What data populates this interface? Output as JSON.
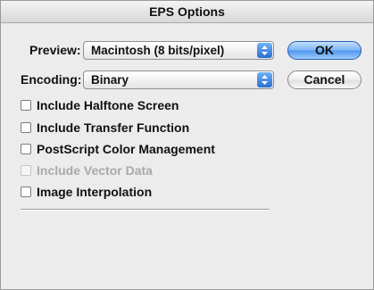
{
  "window": {
    "title": "EPS Options"
  },
  "preview": {
    "label": "Preview:",
    "value": "Macintosh  (8 bits/pixel)"
  },
  "encoding": {
    "label": "Encoding:",
    "value": "Binary"
  },
  "buttons": {
    "ok": "OK",
    "cancel": "Cancel"
  },
  "options": [
    {
      "label": "Include Halftone Screen",
      "checked": false,
      "enabled": true
    },
    {
      "label": "Include Transfer Function",
      "checked": false,
      "enabled": true
    },
    {
      "label": "PostScript Color Management",
      "checked": false,
      "enabled": true
    },
    {
      "label": "Include Vector Data",
      "checked": false,
      "enabled": false
    },
    {
      "label": "Image Interpolation",
      "checked": false,
      "enabled": true
    }
  ]
}
